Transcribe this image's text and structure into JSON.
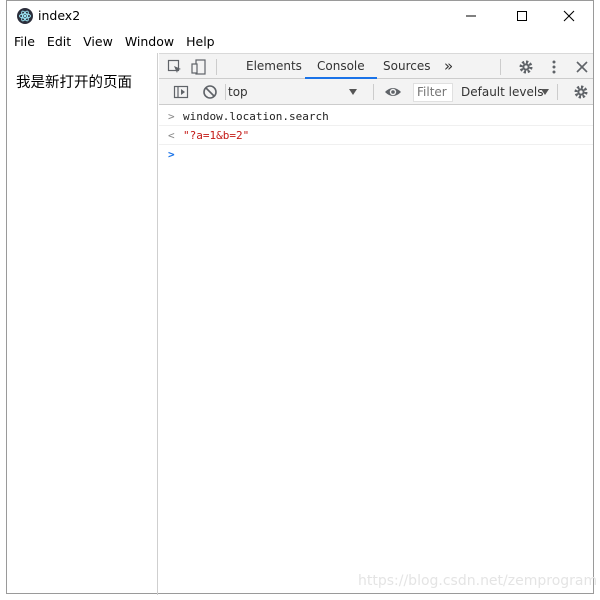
{
  "window": {
    "title": "index2",
    "controls": {
      "minimize": "minimize",
      "maximize": "maximize",
      "close": "close"
    }
  },
  "menu": [
    "File",
    "Edit",
    "View",
    "Window",
    "Help"
  ],
  "page": {
    "text": "我是新打开的页面"
  },
  "devtools": {
    "tabs": [
      "Elements",
      "Console",
      "Sources"
    ],
    "active_tab": "Console",
    "more_tabs_glyph": "»",
    "context": "top",
    "filter_placeholder": "Filter",
    "levels": "Default levels",
    "accent_color": "#1a73e8"
  },
  "console": {
    "input": "window.location.search",
    "result": "\"?a=1&b=2\"",
    "input_glyph": ">",
    "result_glyph": "<",
    "caret_glyph": ">"
  },
  "watermark": "https://blog.csdn.net/zemprogram"
}
